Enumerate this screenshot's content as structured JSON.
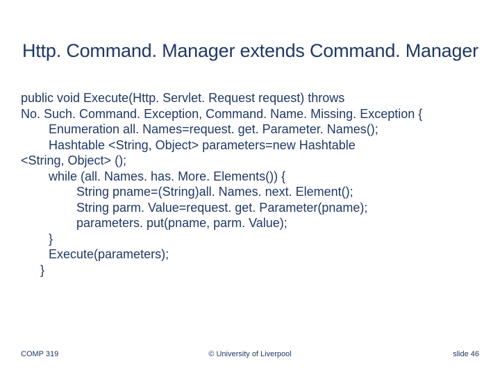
{
  "title": "Http. Command. Manager extends Command. Manager",
  "code": {
    "l1": " public void Execute(Http. Servlet. Request request) throws",
    "l2": "No. Such. Command. Exception, Command. Name. Missing. Exception {",
    "l3": "Enumeration all. Names=request. get. Parameter. Names();",
    "l4": "Hashtable <String, Object> parameters=new Hashtable",
    "l5": "<String, Object> ();",
    "l6": "while (all. Names. has. More. Elements()) {",
    "l7": "String pname=(String)all. Names. next. Element();",
    "l8": "String parm. Value=request. get. Parameter(pname);",
    "l9": "parameters. put(pname, parm. Value);",
    "l10": "}",
    "l11": "Execute(parameters);",
    "l12": "}"
  },
  "footer": {
    "left": "COMP 319",
    "center": "© University of Liverpool",
    "right": "slide  46"
  }
}
